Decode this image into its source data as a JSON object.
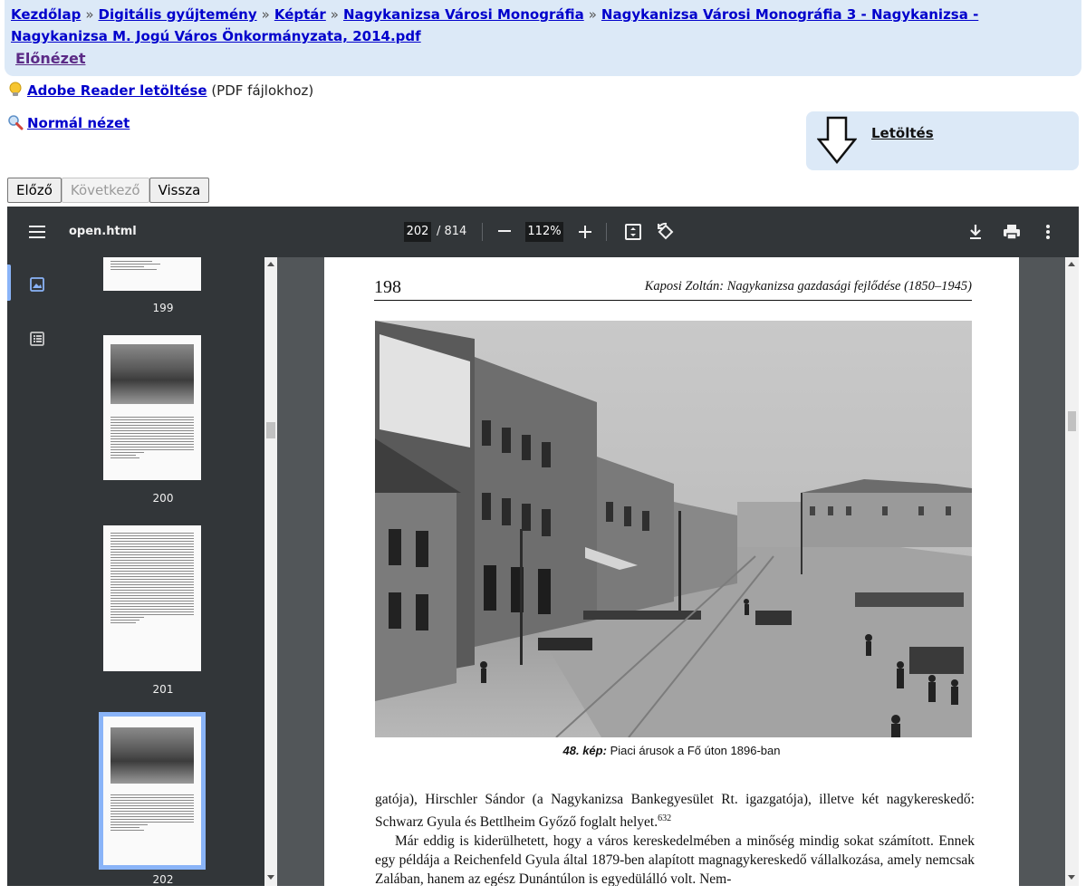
{
  "breadcrumb": {
    "items": [
      "Kezdőlap",
      "Digitális gyűjtemény",
      "Képtár",
      "Nagykanizsa Városi Monográfia",
      "Nagykanizsa Városi Monográfia 3 - Nagykanizsa - Nagykanizsa M. Jogú Város Önkormányzata, 2014.pdf"
    ],
    "separator": "»"
  },
  "preview_link": "Előnézet",
  "adobe": {
    "link": "Adobe Reader letöltése",
    "note": "(PDF fájlokhoz)"
  },
  "normal_view": "Normál nézet",
  "download": {
    "label": "Letöltés"
  },
  "nav_buttons": {
    "prev": "Előző",
    "next": "Következő",
    "back": "Vissza"
  },
  "viewer": {
    "filename": "open.html",
    "current_page": "202",
    "total_pages": "/ 814",
    "zoom": "112%",
    "thumbnails": [
      "199",
      "200",
      "201",
      "202"
    ],
    "selected_thumbnail": "202"
  },
  "pdf_page": {
    "page_number": "198",
    "running_head": "Kaposi Zoltán: Nagykanizsa gazdasági fejlődése (1850–1945)",
    "caption_label": "48. kép:",
    "caption_text": "Piaci árusok a Fő úton 1896-ban",
    "para1": "gatója), Hirschler Sándor (a Nagykanizsa Bankegyesület Rt. igazgatója), illetve két nagykereskedő: Schwarz Gyula és Bettlheim Győző foglalt helyet.",
    "para1_footnote": "632",
    "para2": "Már eddig is kiderülhetett, hogy a város kereskedelmében a minőség mindig sokat számított. Ennek egy példája a Reichenfeld Gyula által 1879-ben alapított magnagykereskedő vállalkozása, amely nemcsak Zalában, hanem az egész Dunántúlon is egyedülálló volt. Nem-"
  }
}
